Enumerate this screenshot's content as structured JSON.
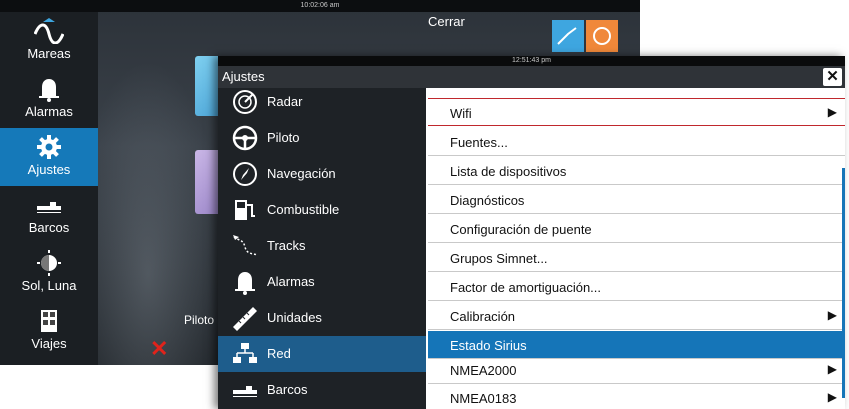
{
  "background": {
    "clock": "10:02:06 am",
    "cerrar_label": "Cerrar",
    "piloto_label": "Piloto",
    "sidebar": [
      {
        "label": "Mareas",
        "icon": "tide-wave-icon",
        "active": false
      },
      {
        "label": "Alarmas",
        "icon": "bell-icon",
        "active": false
      },
      {
        "label": "Ajustes",
        "icon": "gear-icon",
        "active": true
      },
      {
        "label": "Barcos",
        "icon": "ship-icon",
        "active": false
      },
      {
        "label": "Sol, Luna",
        "icon": "sun-moon-icon",
        "active": false
      },
      {
        "label": "Viajes",
        "icon": "calculator-icon",
        "active": false
      }
    ]
  },
  "dialog": {
    "clock": "12:51:43 pm",
    "title": "Ajustes",
    "close_icon": "close-x-icon",
    "left_items": [
      {
        "label": "Radar",
        "icon": "radar-icon",
        "active": false
      },
      {
        "label": "Piloto",
        "icon": "steering-wheel-icon",
        "active": false
      },
      {
        "label": "Navegación",
        "icon": "compass-icon",
        "active": false
      },
      {
        "label": "Combustible",
        "icon": "fuel-pump-icon",
        "active": false
      },
      {
        "label": "Tracks",
        "icon": "track-icon",
        "active": false
      },
      {
        "label": "Alarmas",
        "icon": "bell-icon",
        "active": false
      },
      {
        "label": "Unidades",
        "icon": "ruler-icon",
        "active": false
      },
      {
        "label": "Red",
        "icon": "network-icon",
        "active": true
      },
      {
        "label": "Barcos",
        "icon": "ship-icon",
        "active": false
      }
    ],
    "right_items": [
      {
        "label": "Wifi",
        "has_arrow": true,
        "selected": false
      },
      {
        "label": "Fuentes...",
        "has_arrow": false,
        "selected": false
      },
      {
        "label": "Lista de dispositivos",
        "has_arrow": false,
        "selected": false
      },
      {
        "label": "Diagnósticos",
        "has_arrow": false,
        "selected": false
      },
      {
        "label": "Configuración de puente",
        "has_arrow": false,
        "selected": false
      },
      {
        "label": "Grupos Simnet...",
        "has_arrow": false,
        "selected": false
      },
      {
        "label": "Factor de amortiguación...",
        "has_arrow": false,
        "selected": false
      },
      {
        "label": "Calibración",
        "has_arrow": true,
        "selected": false
      },
      {
        "label": "Estado Sirius",
        "has_arrow": false,
        "selected": true
      },
      {
        "label": "NMEA2000",
        "has_arrow": true,
        "selected": false
      },
      {
        "label": "NMEA0183",
        "has_arrow": true,
        "selected": false
      }
    ]
  },
  "colors": {
    "accent_blue": "#1575b8",
    "active_left": "#1e5d8c",
    "alert_red": "#e0231b"
  }
}
